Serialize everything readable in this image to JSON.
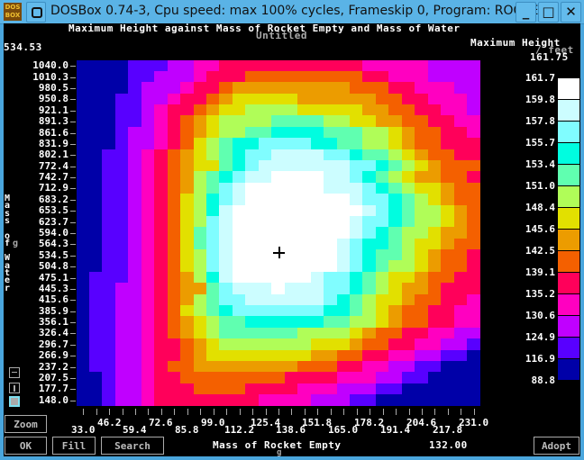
{
  "window": {
    "title": "DOSBox 0.74-3, Cpu speed: max 100% cycles, Frameskip 0, Program: ROCKET4",
    "app_icon_text": [
      "DOS",
      "BOX"
    ],
    "minimize_glyph": "_",
    "maximize_glyph": "□",
    "close_glyph": "✕"
  },
  "plot": {
    "title": "Maximum Height against Mass of Rocket Empty and Mass of Water",
    "subtitle": "Untitled",
    "cursor_y_value": "534.53",
    "cursor_x_value": "132.00",
    "z_label_line1": "Maximum Height",
    "z_label_line2": "/ feet",
    "cursor_z_value": "161.75",
    "y_axis_label_chars": [
      "M",
      "a",
      "s",
      "s",
      " ",
      "o",
      "f",
      " ",
      "W",
      "a",
      "t",
      "e",
      "r"
    ],
    "y_axis_unit": "g",
    "x_axis_label": "Mass of Rocket Empty",
    "x_axis_unit": "g"
  },
  "buttons": {
    "zoom": "Zoom",
    "ok": "OK",
    "fill": "Fill",
    "search": "Search",
    "adopt": "Adopt"
  },
  "chart_data": {
    "type": "heatmap",
    "title": "Maximum Height against Mass of Rocket Empty and Mass of Water",
    "subtitle": "Untitled",
    "xlabel": "Mass of Rocket Empty / g",
    "ylabel": "Mass of Water / g",
    "zlabel": "Maximum Height / feet",
    "x_ticks": [
      "33.0",
      "46.2",
      "59.4",
      "72.6",
      "85.8",
      "99.0",
      "112.2",
      "125.4",
      "138.6",
      "151.8",
      "165.0",
      "178.2",
      "191.4",
      "204.6",
      "217.8",
      "231.0"
    ],
    "y_ticks": [
      "1040.0",
      "1010.3",
      "980.5",
      "950.8",
      "921.1",
      "891.3",
      "861.6",
      "831.9",
      "802.1",
      "772.4",
      "742.7",
      "712.9",
      "683.2",
      "653.5",
      "623.7",
      "594.0",
      "564.3",
      "534.5",
      "504.8",
      "475.1",
      "445.3",
      "415.6",
      "385.9",
      "356.1",
      "326.4",
      "296.7",
      "266.9",
      "237.2",
      "207.5",
      "177.7",
      "148.0"
    ],
    "xlim": [
      33.0,
      231.0
    ],
    "ylim": [
      148.0,
      1040.0
    ],
    "legend_levels": [
      "161.7",
      "159.8",
      "157.8",
      "155.7",
      "153.4",
      "151.0",
      "148.4",
      "145.6",
      "142.5",
      "139.1",
      "135.2",
      "130.6",
      "124.9",
      "116.9",
      "88.8"
    ],
    "legend_colors": [
      "#ffffff",
      "#ccfdff",
      "#80fdff",
      "#00fde0",
      "#60ffb0",
      "#b0fd58",
      "#e2e000",
      "#ec9c00",
      "#f46000",
      "#ff005a",
      "#ff00c0",
      "#c000ff",
      "#5800ff",
      "#0000a8"
    ],
    "cursor": {
      "x": 132.0,
      "y": 534.53,
      "z": 161.75
    },
    "grid_rows_top_to_bottom": [
      "0000111223344444444444333332222",
      "0000112223444555555555443332222",
      "0000122234456666666665554433322",
      "0001122344567777766666655443332",
      "0001123445677888877777665544332",
      "0001123456788889999887766554433",
      "000122345678899aaaa999887655443",
      "000122345789aabbbbaa9988765544",
      "001123456789abbccccbba99876554",
      "0011234567 9abcccccccbba987655",
      "00112345689abccddddccba98766554",
      "00112345689bcddddddcccba9877655",
      "0011234578abcddddddddcbba987655",
      "0011234578acddddddddddcba988765",
      "0011234578bcdddddddddcbba988765",
      "0011234579bcdddddddddcba9887665",
      "0011234579bcddddddddcbaa9877655",
      "0011234578bcddddddddcba99876554",
      "0011234578bcddddddddcba98876554",
      "0111234568acddddddcbba987765544",
      "011223456 9bcccdcccbba98766544",
      "01122345689bbccccccba9877655443",
      "01122345789abbbbbbbaa9876554433",
      "0112234567899aaaaaa99887655443",
      "0112234567899999988887655443322",
      "01122344567888888877765544332211",
      "0112234456777777776655443322110",
      "0112234556666666655544332211000",
      "0012234455555555444433322110000",
      "0012234445555444433322211000000",
      "0012234444444433332221100000000"
    ]
  }
}
